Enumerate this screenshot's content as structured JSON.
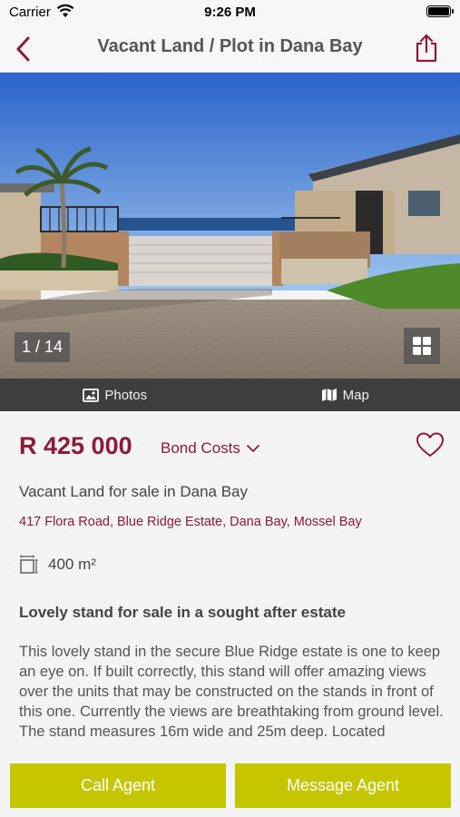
{
  "status_bar": {
    "carrier": "Carrier",
    "time": "9:26 PM"
  },
  "nav": {
    "title": "Vacant Land / Plot in Dana Bay",
    "back_icon": "chevron-left-icon",
    "share_icon": "share-icon"
  },
  "gallery": {
    "counter": "1 / 14",
    "grid_icon": "grid-icon"
  },
  "media_tabs": [
    {
      "label": "Photos",
      "icon": "photo-icon"
    },
    {
      "label": "Map",
      "icon": "map-icon"
    }
  ],
  "listing": {
    "price": "R 425 000",
    "bond_costs_label": "Bond Costs",
    "subtitle": "Vacant Land for sale in Dana Bay",
    "address": "417 Flora Road, Blue Ridge Estate, Dana Bay, Mossel Bay",
    "size": "400 m²",
    "headline": "Lovely stand for sale in a sought after estate",
    "description": "This lovely stand in the secure Blue Ridge estate is one to keep an eye on. If built correctly, this stand will offer amazing views over the units that may be constructed on the stands in front of this one. Currently the views are breathtaking from ground level. The stand measures 16m wide and 25m deep. Located"
  },
  "actions": {
    "call": "Call Agent",
    "message": "Message Agent"
  },
  "colors": {
    "brand": "#8b1a3b",
    "action": "#c6c600",
    "tab_bar": "#3e3e3e"
  }
}
